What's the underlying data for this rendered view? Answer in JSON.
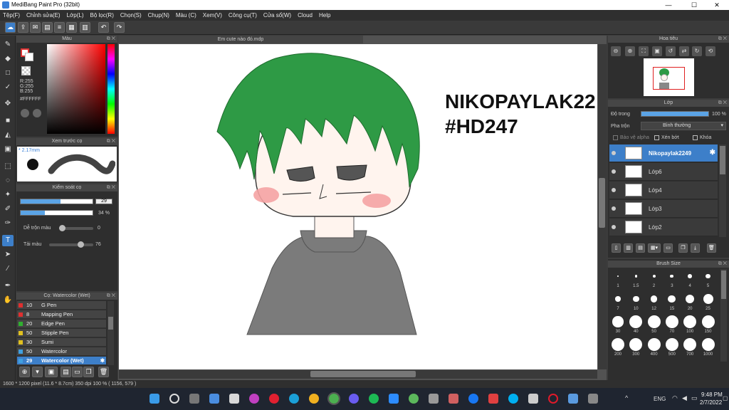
{
  "window": {
    "title": "MediBang Paint Pro (32bit)",
    "minimize": "—",
    "maximize": "☐",
    "close": "✕"
  },
  "menu": [
    "Tệp(F)",
    "Chỉnh sửa(E)",
    "Lớp(L)",
    "Bộ lọc(R)",
    "Chọn(S)",
    "Chụp(N)",
    "Màu (C)",
    "Xem(V)",
    "Công cụ(T)",
    "Cửa sổ(W)",
    "Cloud",
    "Help"
  ],
  "color_panel": {
    "title": "Màu",
    "r": "R:255",
    "g": "G:255",
    "b": "B:255",
    "hex": "#FFFFFF"
  },
  "brush_preview": {
    "title": "Xem trước cọ",
    "size": "2.17mm"
  },
  "brush_control": {
    "title": "Kiểm soát cọ",
    "size_value": "29",
    "size_fraction": 0.55,
    "opacity_value": "34 %",
    "opacity_fraction": 0.34,
    "blend_label": "Dễ trộn màu",
    "blend_value": "0",
    "blend_fraction": 0.0,
    "paint_label": "Tải màu",
    "paint_value": "76",
    "paint_fraction": 0.76
  },
  "brush_list": {
    "title": "Cọ: Watercolor (Wet)",
    "items": [
      {
        "num": "10",
        "name": "G Pen",
        "color": "#e03030"
      },
      {
        "num": "8",
        "name": "Mapping Pen",
        "color": "#e03030"
      },
      {
        "num": "20",
        "name": "Edge Pen",
        "color": "#30b030"
      },
      {
        "num": "50",
        "name": "Stipple Pen",
        "color": "#e0c020"
      },
      {
        "num": "30",
        "name": "Sumi",
        "color": "#e0c020"
      },
      {
        "num": "50",
        "name": "Watercolor",
        "color": "#40a0e0"
      },
      {
        "num": "29",
        "name": "Watercolor (Wet)",
        "color": "#40a0e0"
      }
    ]
  },
  "document": {
    "tab": "Em cute nào đó.mdp",
    "text_line1": "NIKOPAYLAK22",
    "text_line2": "#HD247"
  },
  "navigator": {
    "title": "Hoa tiêu"
  },
  "layers": {
    "title": "Lớp",
    "opacity_label": "Độ trong",
    "opacity_value": "100 %",
    "opacity_fraction": 1.0,
    "blend_label": "Pha trộn",
    "blend_value": "Bình thường",
    "alpha_label": "Bảo vệ alpha",
    "clip_label": "Xén bớt",
    "lock_label": "Khóa",
    "items": [
      {
        "name": "Nikopaylak2249"
      },
      {
        "name": "Lớp6"
      },
      {
        "name": "Lớp4"
      },
      {
        "name": "Lớp3"
      },
      {
        "name": "Lớp2"
      }
    ]
  },
  "brush_size": {
    "title": "Brush Size",
    "sizes": [
      "1",
      "1.5",
      "2",
      "3",
      "4",
      "5",
      "7",
      "10",
      "12",
      "15",
      "20",
      "25",
      "30",
      "40",
      "50",
      "70",
      "100",
      "150",
      "200",
      "300",
      "400",
      "500",
      "700",
      "1000"
    ]
  },
  "status": {
    "text": "1600 * 1200 pixel   (11.6 * 8.7cm)  350 dpi  100 %  ( 1156, 579 )"
  },
  "taskbar": {
    "lang": "ENG",
    "time": "9:48 PM",
    "date": "2/7/2022",
    "up": "^"
  }
}
